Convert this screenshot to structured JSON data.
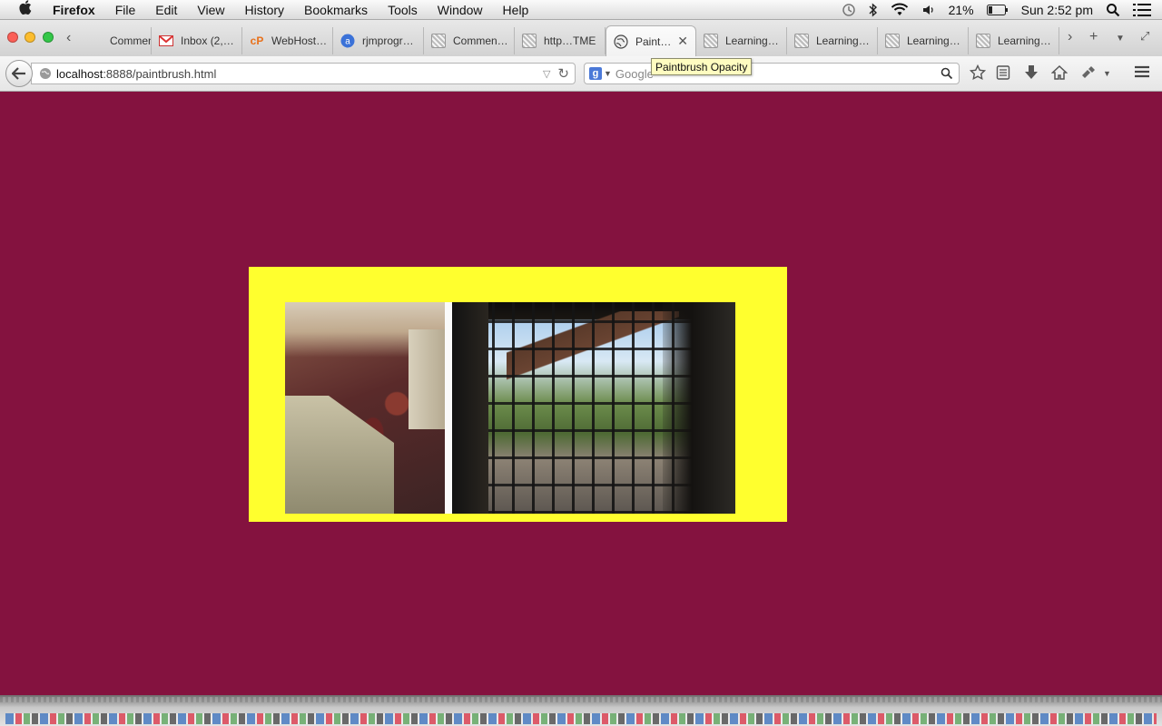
{
  "menubar": {
    "app_name": "Firefox",
    "items": [
      "File",
      "Edit",
      "View",
      "History",
      "Bookmarks",
      "Tools",
      "Window",
      "Help"
    ],
    "battery": "21%",
    "clock": "Sun 2:52 pm"
  },
  "tabs": [
    {
      "label": "Commen…",
      "icon": "generic-page-icon"
    },
    {
      "label": "Inbox (2,…",
      "icon": "gmail-icon"
    },
    {
      "label": "WebHost…",
      "icon": "cpanel-icon"
    },
    {
      "label": "rjmprogr…",
      "icon": "blue-a-icon"
    },
    {
      "label": "Commen…",
      "icon": "generic-page-icon"
    },
    {
      "label": "http…TME",
      "icon": "generic-page-icon"
    },
    {
      "label": "Paint…",
      "icon": "globe-icon",
      "active": true
    },
    {
      "label": "Learning…",
      "icon": "generic-page-icon"
    },
    {
      "label": "Learning…",
      "icon": "generic-page-icon"
    },
    {
      "label": "Learning…",
      "icon": "generic-page-icon"
    },
    {
      "label": "Learning…",
      "icon": "generic-page-icon"
    }
  ],
  "navbar": {
    "url_host": "localhost",
    "url_rest": ":8888/paintbrush.html",
    "search_placeholder": "Google",
    "search_engine_letter": "g"
  },
  "tooltip": "Paintbrush Opacity",
  "page": {
    "background": "#84123f",
    "frame_color": "#ffff2e"
  }
}
